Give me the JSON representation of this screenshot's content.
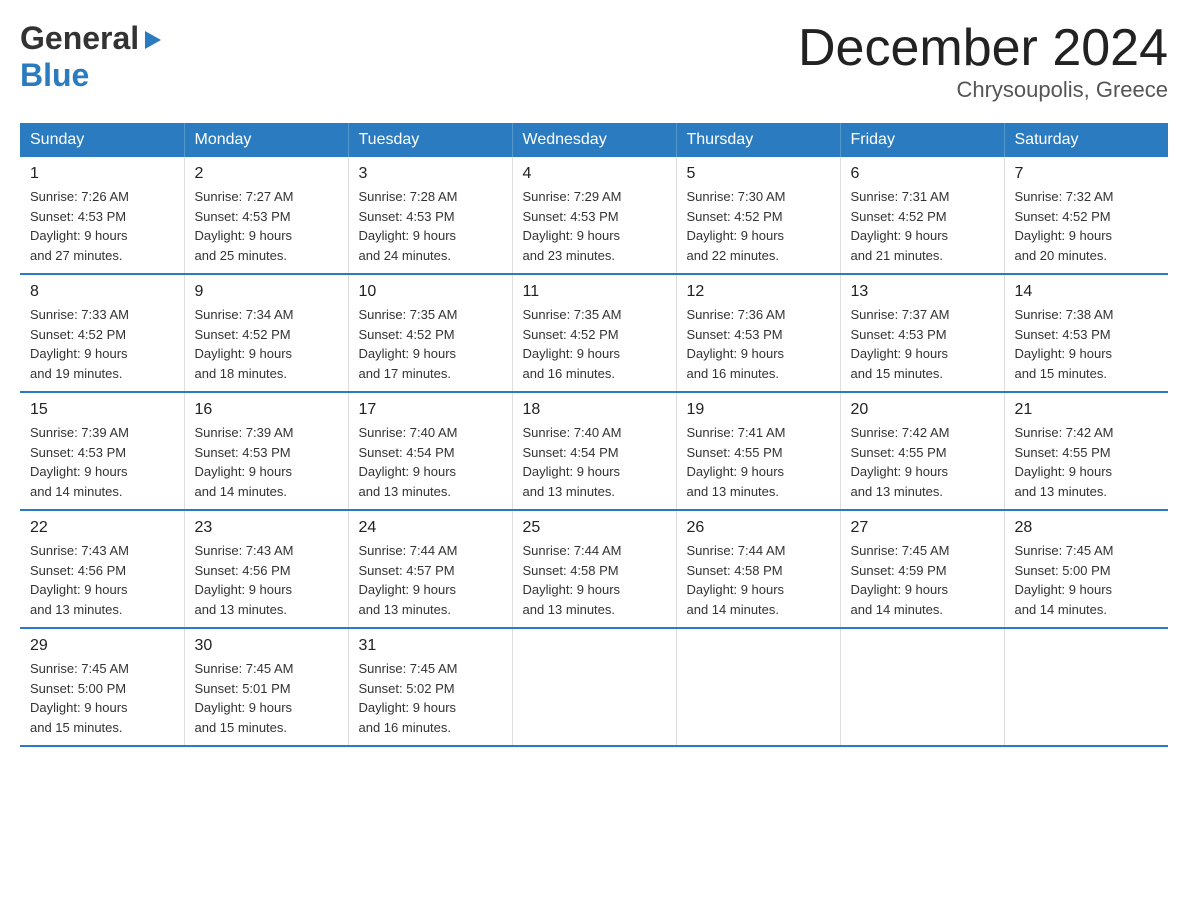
{
  "logo": {
    "line1": "General",
    "arrow": "▶",
    "line2": "Blue"
  },
  "title": "December 2024",
  "subtitle": "Chrysoupolis, Greece",
  "weekdays": [
    "Sunday",
    "Monday",
    "Tuesday",
    "Wednesday",
    "Thursday",
    "Friday",
    "Saturday"
  ],
  "weeks": [
    [
      {
        "day": "1",
        "sunrise": "7:26 AM",
        "sunset": "4:53 PM",
        "daylight": "9 hours and 27 minutes."
      },
      {
        "day": "2",
        "sunrise": "7:27 AM",
        "sunset": "4:53 PM",
        "daylight": "9 hours and 25 minutes."
      },
      {
        "day": "3",
        "sunrise": "7:28 AM",
        "sunset": "4:53 PM",
        "daylight": "9 hours and 24 minutes."
      },
      {
        "day": "4",
        "sunrise": "7:29 AM",
        "sunset": "4:53 PM",
        "daylight": "9 hours and 23 minutes."
      },
      {
        "day": "5",
        "sunrise": "7:30 AM",
        "sunset": "4:52 PM",
        "daylight": "9 hours and 22 minutes."
      },
      {
        "day": "6",
        "sunrise": "7:31 AM",
        "sunset": "4:52 PM",
        "daylight": "9 hours and 21 minutes."
      },
      {
        "day": "7",
        "sunrise": "7:32 AM",
        "sunset": "4:52 PM",
        "daylight": "9 hours and 20 minutes."
      }
    ],
    [
      {
        "day": "8",
        "sunrise": "7:33 AM",
        "sunset": "4:52 PM",
        "daylight": "9 hours and 19 minutes."
      },
      {
        "day": "9",
        "sunrise": "7:34 AM",
        "sunset": "4:52 PM",
        "daylight": "9 hours and 18 minutes."
      },
      {
        "day": "10",
        "sunrise": "7:35 AM",
        "sunset": "4:52 PM",
        "daylight": "9 hours and 17 minutes."
      },
      {
        "day": "11",
        "sunrise": "7:35 AM",
        "sunset": "4:52 PM",
        "daylight": "9 hours and 16 minutes."
      },
      {
        "day": "12",
        "sunrise": "7:36 AM",
        "sunset": "4:53 PM",
        "daylight": "9 hours and 16 minutes."
      },
      {
        "day": "13",
        "sunrise": "7:37 AM",
        "sunset": "4:53 PM",
        "daylight": "9 hours and 15 minutes."
      },
      {
        "day": "14",
        "sunrise": "7:38 AM",
        "sunset": "4:53 PM",
        "daylight": "9 hours and 15 minutes."
      }
    ],
    [
      {
        "day": "15",
        "sunrise": "7:39 AM",
        "sunset": "4:53 PM",
        "daylight": "9 hours and 14 minutes."
      },
      {
        "day": "16",
        "sunrise": "7:39 AM",
        "sunset": "4:53 PM",
        "daylight": "9 hours and 14 minutes."
      },
      {
        "day": "17",
        "sunrise": "7:40 AM",
        "sunset": "4:54 PM",
        "daylight": "9 hours and 13 minutes."
      },
      {
        "day": "18",
        "sunrise": "7:40 AM",
        "sunset": "4:54 PM",
        "daylight": "9 hours and 13 minutes."
      },
      {
        "day": "19",
        "sunrise": "7:41 AM",
        "sunset": "4:55 PM",
        "daylight": "9 hours and 13 minutes."
      },
      {
        "day": "20",
        "sunrise": "7:42 AM",
        "sunset": "4:55 PM",
        "daylight": "9 hours and 13 minutes."
      },
      {
        "day": "21",
        "sunrise": "7:42 AM",
        "sunset": "4:55 PM",
        "daylight": "9 hours and 13 minutes."
      }
    ],
    [
      {
        "day": "22",
        "sunrise": "7:43 AM",
        "sunset": "4:56 PM",
        "daylight": "9 hours and 13 minutes."
      },
      {
        "day": "23",
        "sunrise": "7:43 AM",
        "sunset": "4:56 PM",
        "daylight": "9 hours and 13 minutes."
      },
      {
        "day": "24",
        "sunrise": "7:44 AM",
        "sunset": "4:57 PM",
        "daylight": "9 hours and 13 minutes."
      },
      {
        "day": "25",
        "sunrise": "7:44 AM",
        "sunset": "4:58 PM",
        "daylight": "9 hours and 13 minutes."
      },
      {
        "day": "26",
        "sunrise": "7:44 AM",
        "sunset": "4:58 PM",
        "daylight": "9 hours and 14 minutes."
      },
      {
        "day": "27",
        "sunrise": "7:45 AM",
        "sunset": "4:59 PM",
        "daylight": "9 hours and 14 minutes."
      },
      {
        "day": "28",
        "sunrise": "7:45 AM",
        "sunset": "5:00 PM",
        "daylight": "9 hours and 14 minutes."
      }
    ],
    [
      {
        "day": "29",
        "sunrise": "7:45 AM",
        "sunset": "5:00 PM",
        "daylight": "9 hours and 15 minutes."
      },
      {
        "day": "30",
        "sunrise": "7:45 AM",
        "sunset": "5:01 PM",
        "daylight": "9 hours and 15 minutes."
      },
      {
        "day": "31",
        "sunrise": "7:45 AM",
        "sunset": "5:02 PM",
        "daylight": "9 hours and 16 minutes."
      },
      {
        "day": "",
        "sunrise": "",
        "sunset": "",
        "daylight": ""
      },
      {
        "day": "",
        "sunrise": "",
        "sunset": "",
        "daylight": ""
      },
      {
        "day": "",
        "sunrise": "",
        "sunset": "",
        "daylight": ""
      },
      {
        "day": "",
        "sunrise": "",
        "sunset": "",
        "daylight": ""
      }
    ]
  ],
  "labels": {
    "sunrise_prefix": "Sunrise: ",
    "sunset_prefix": "Sunset: ",
    "daylight_prefix": "Daylight: "
  }
}
